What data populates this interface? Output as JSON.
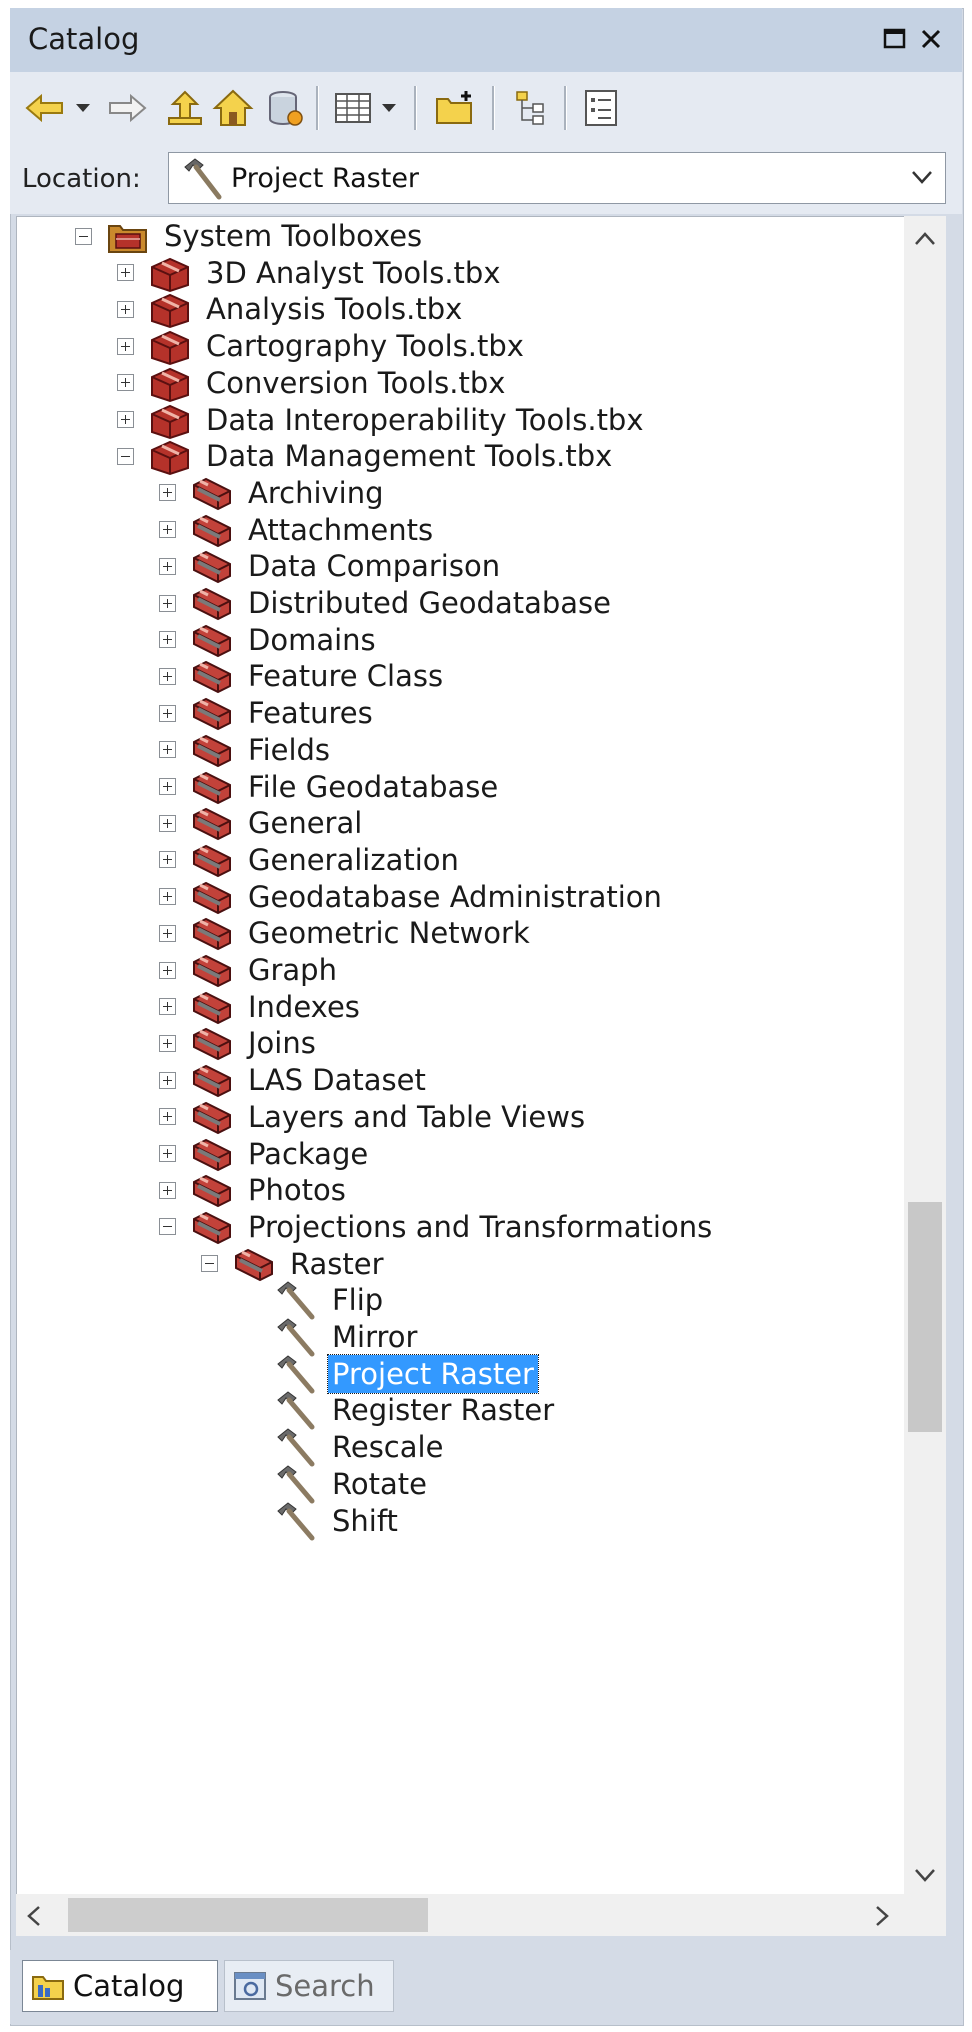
{
  "window": {
    "title": "Catalog"
  },
  "location": {
    "label": "Location:",
    "value": "Project Raster"
  },
  "tree": [
    {
      "label": "System Toolboxes",
      "depth": 0,
      "expander": "minus",
      "icon": "system-toolbox-folder-icon"
    },
    {
      "label": "3D Analyst Tools.tbx",
      "depth": 1,
      "expander": "plus",
      "icon": "toolbox-icon"
    },
    {
      "label": "Analysis Tools.tbx",
      "depth": 1,
      "expander": "plus",
      "icon": "toolbox-icon"
    },
    {
      "label": "Cartography Tools.tbx",
      "depth": 1,
      "expander": "plus",
      "icon": "toolbox-icon"
    },
    {
      "label": "Conversion Tools.tbx",
      "depth": 1,
      "expander": "plus",
      "icon": "toolbox-icon"
    },
    {
      "label": "Data Interoperability Tools.tbx",
      "depth": 1,
      "expander": "plus",
      "icon": "toolbox-icon"
    },
    {
      "label": "Data Management Tools.tbx",
      "depth": 1,
      "expander": "minus",
      "icon": "toolbox-icon"
    },
    {
      "label": "Archiving",
      "depth": 2,
      "expander": "plus",
      "icon": "toolset-icon"
    },
    {
      "label": "Attachments",
      "depth": 2,
      "expander": "plus",
      "icon": "toolset-icon"
    },
    {
      "label": "Data Comparison",
      "depth": 2,
      "expander": "plus",
      "icon": "toolset-icon"
    },
    {
      "label": "Distributed Geodatabase",
      "depth": 2,
      "expander": "plus",
      "icon": "toolset-icon"
    },
    {
      "label": "Domains",
      "depth": 2,
      "expander": "plus",
      "icon": "toolset-icon"
    },
    {
      "label": "Feature Class",
      "depth": 2,
      "expander": "plus",
      "icon": "toolset-icon"
    },
    {
      "label": "Features",
      "depth": 2,
      "expander": "plus",
      "icon": "toolset-icon"
    },
    {
      "label": "Fields",
      "depth": 2,
      "expander": "plus",
      "icon": "toolset-icon"
    },
    {
      "label": "File Geodatabase",
      "depth": 2,
      "expander": "plus",
      "icon": "toolset-icon"
    },
    {
      "label": "General",
      "depth": 2,
      "expander": "plus",
      "icon": "toolset-icon"
    },
    {
      "label": "Generalization",
      "depth": 2,
      "expander": "plus",
      "icon": "toolset-icon"
    },
    {
      "label": "Geodatabase Administration",
      "depth": 2,
      "expander": "plus",
      "icon": "toolset-icon"
    },
    {
      "label": "Geometric Network",
      "depth": 2,
      "expander": "plus",
      "icon": "toolset-icon"
    },
    {
      "label": "Graph",
      "depth": 2,
      "expander": "plus",
      "icon": "toolset-icon"
    },
    {
      "label": "Indexes",
      "depth": 2,
      "expander": "plus",
      "icon": "toolset-icon"
    },
    {
      "label": "Joins",
      "depth": 2,
      "expander": "plus",
      "icon": "toolset-icon"
    },
    {
      "label": "LAS Dataset",
      "depth": 2,
      "expander": "plus",
      "icon": "toolset-icon"
    },
    {
      "label": "Layers and Table Views",
      "depth": 2,
      "expander": "plus",
      "icon": "toolset-icon"
    },
    {
      "label": "Package",
      "depth": 2,
      "expander": "plus",
      "icon": "toolset-icon"
    },
    {
      "label": "Photos",
      "depth": 2,
      "expander": "plus",
      "icon": "toolset-icon"
    },
    {
      "label": "Projections and Transformations",
      "depth": 2,
      "expander": "minus",
      "icon": "toolset-icon"
    },
    {
      "label": "Raster",
      "depth": 3,
      "expander": "minus",
      "icon": "toolset-icon"
    },
    {
      "label": "Flip",
      "depth": 4,
      "expander": "none",
      "icon": "hammer-icon"
    },
    {
      "label": "Mirror",
      "depth": 4,
      "expander": "none",
      "icon": "hammer-icon"
    },
    {
      "label": "Project Raster",
      "depth": 4,
      "expander": "none",
      "icon": "hammer-icon",
      "selected": true
    },
    {
      "label": "Register Raster",
      "depth": 4,
      "expander": "none",
      "icon": "hammer-icon"
    },
    {
      "label": "Rescale",
      "depth": 4,
      "expander": "none",
      "icon": "hammer-icon"
    },
    {
      "label": "Rotate",
      "depth": 4,
      "expander": "none",
      "icon": "hammer-icon"
    },
    {
      "label": "Shift",
      "depth": 4,
      "expander": "none",
      "icon": "hammer-icon"
    }
  ],
  "tabs": [
    {
      "label": "Catalog",
      "active": true,
      "icon": "catalog-icon"
    },
    {
      "label": "Search",
      "active": false,
      "icon": "search-window-icon"
    }
  ],
  "colors": {
    "selection": "#3399ff",
    "title_bar": "#c5d2e3",
    "toolbox_red": "#b5322a"
  }
}
